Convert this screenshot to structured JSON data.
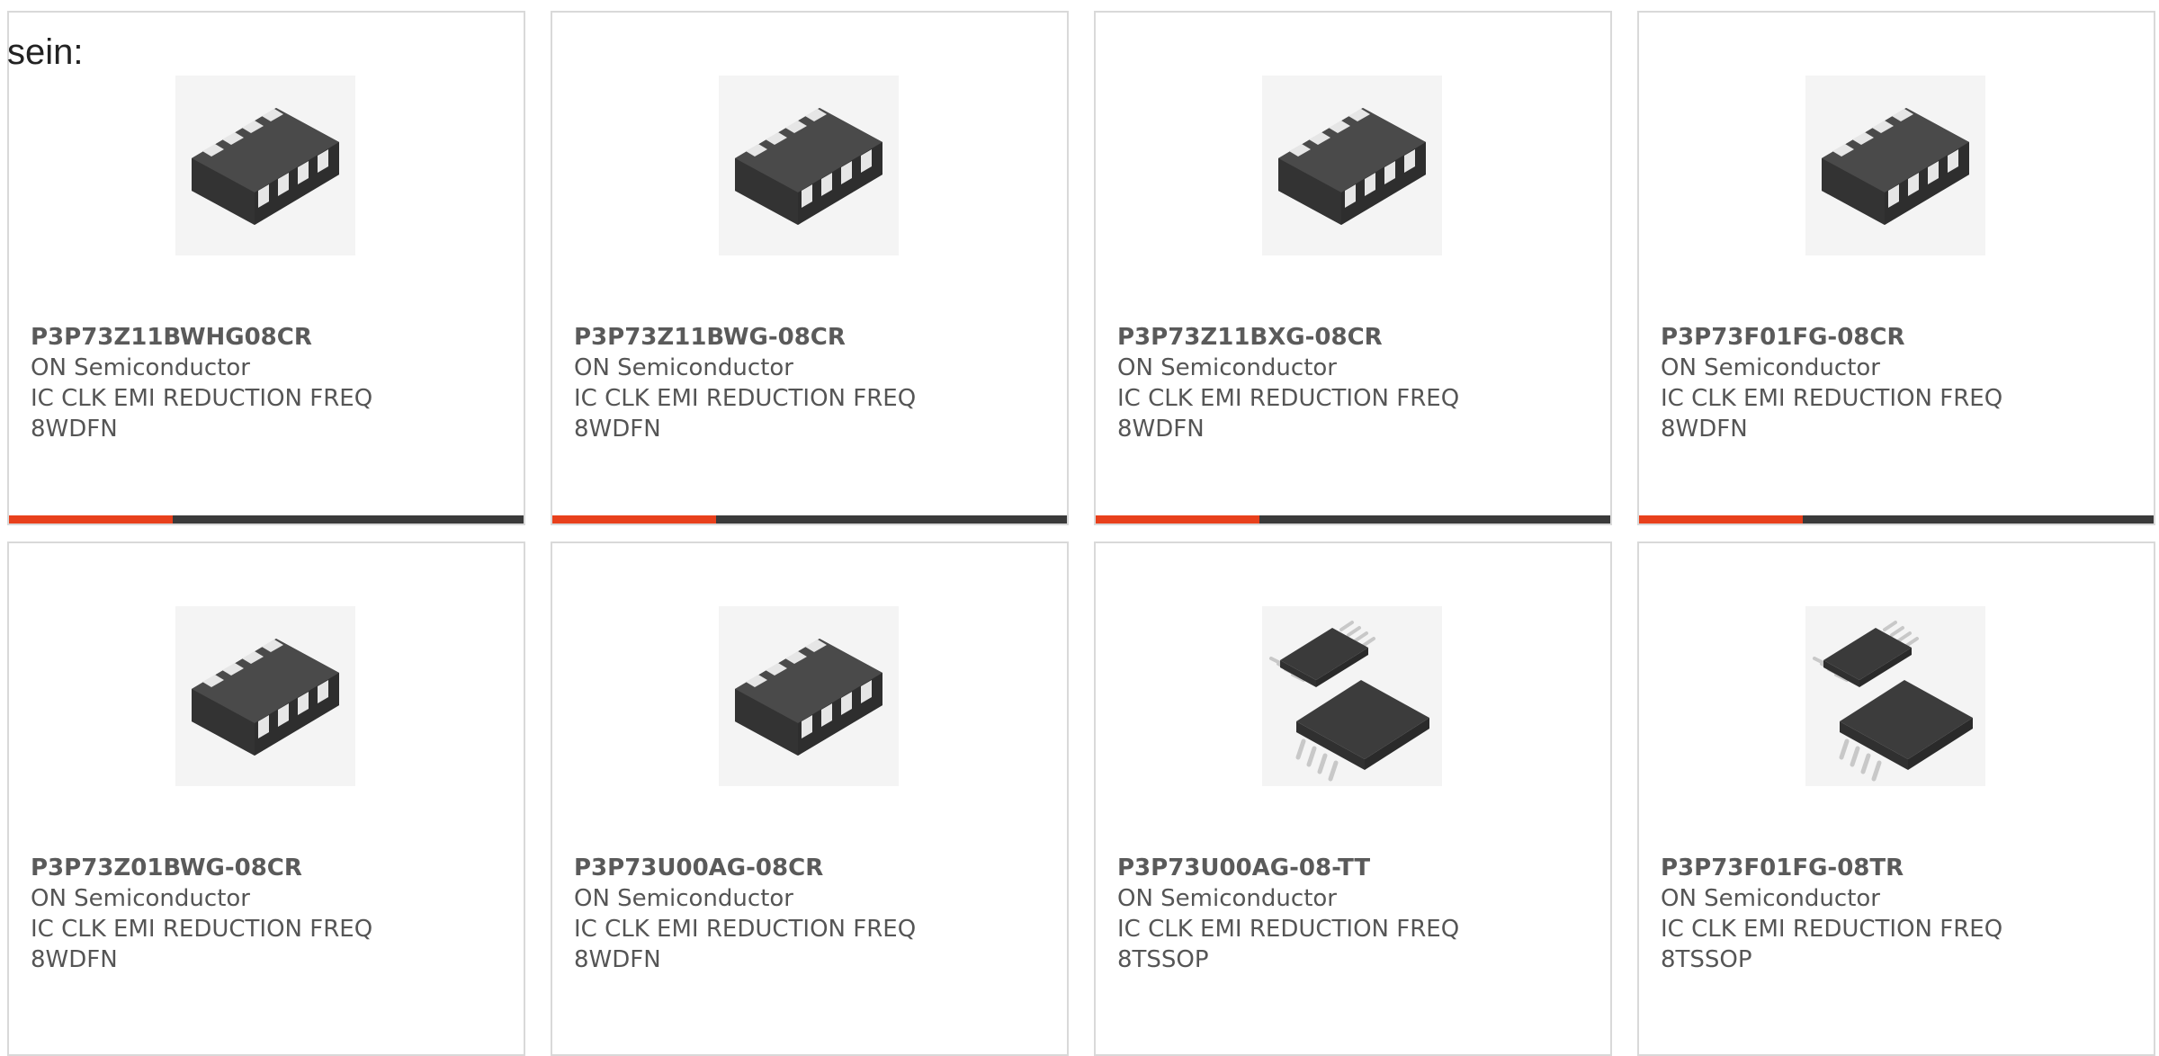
{
  "intro_text": "sein:",
  "accent_color": "#e8401c",
  "products": [
    {
      "part": "P3P73Z11BWHG08CR",
      "maker": "ON Semiconductor",
      "desc": "IC CLK EMI REDUCTION FREQ",
      "pkg": "8WDFN",
      "image_icon": "wdfn-chip-icon"
    },
    {
      "part": "P3P73Z11BWG-08CR",
      "maker": "ON Semiconductor",
      "desc": "IC CLK EMI REDUCTION FREQ",
      "pkg": "8WDFN",
      "image_icon": "wdfn-chip-icon"
    },
    {
      "part": "P3P73Z11BXG-08CR",
      "maker": "ON Semiconductor",
      "desc": "IC CLK EMI REDUCTION FREQ",
      "pkg": "8WDFN",
      "image_icon": "wdfn-chip-icon"
    },
    {
      "part": "P3P73F01FG-08CR",
      "maker": "ON Semiconductor",
      "desc": "IC CLK EMI REDUCTION FREQ",
      "pkg": "8WDFN",
      "image_icon": "wdfn-chip-icon"
    },
    {
      "part": "P3P73Z01BWG-08CR",
      "maker": "ON Semiconductor",
      "desc": "IC CLK EMI REDUCTION FREQ",
      "pkg": "8WDFN",
      "image_icon": "wdfn-chip-icon"
    },
    {
      "part": "P3P73U00AG-08CR",
      "maker": "ON Semiconductor",
      "desc": "IC CLK EMI REDUCTION FREQ",
      "pkg": "8WDFN",
      "image_icon": "wdfn-chip-icon"
    },
    {
      "part": "P3P73U00AG-08-TT",
      "maker": "ON Semiconductor",
      "desc": "IC CLK EMI REDUCTION FREQ",
      "pkg": "8TSSOP",
      "image_icon": "tssop-chip-icon"
    },
    {
      "part": "P3P73F01FG-08TR",
      "maker": "ON Semiconductor",
      "desc": "IC CLK EMI REDUCTION FREQ",
      "pkg": "8TSSOP",
      "image_icon": "tssop-chip-icon"
    }
  ]
}
